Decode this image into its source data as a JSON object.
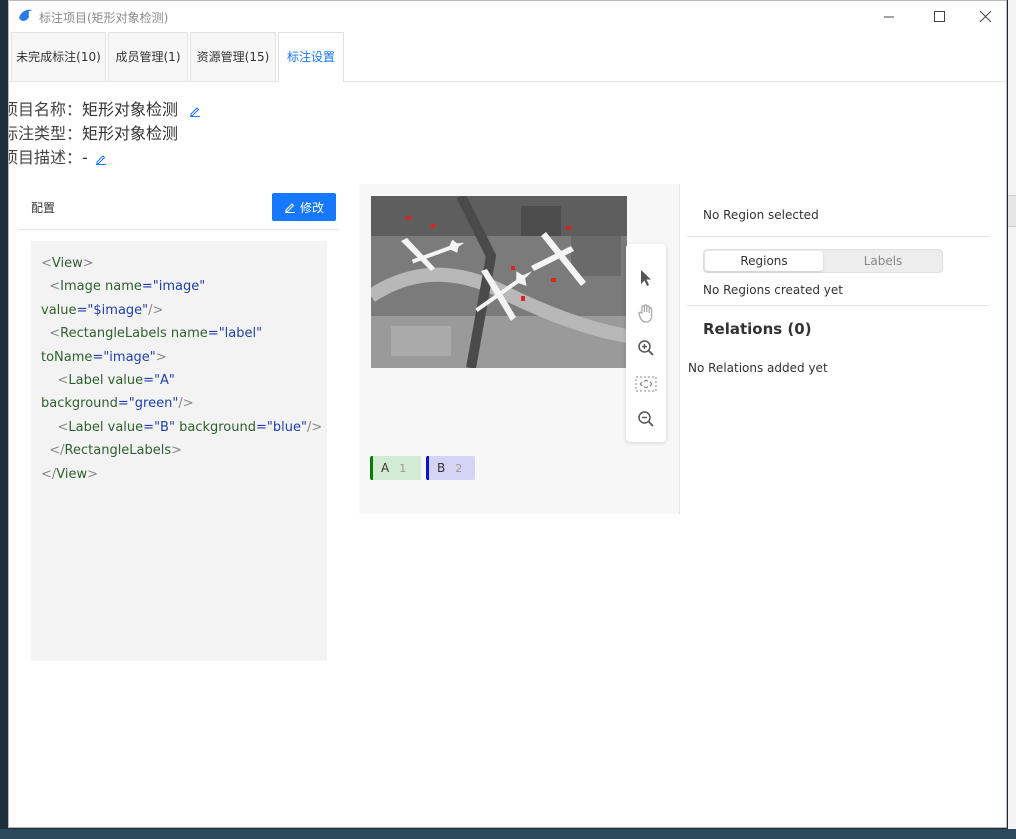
{
  "window": {
    "title": "标注项目(矩形对象检测)",
    "controls": {
      "minimize": "—",
      "maximize": "☐",
      "close": "✕"
    }
  },
  "tabs": [
    {
      "label": "未完成标注(10)"
    },
    {
      "label": "成员管理(1)"
    },
    {
      "label": "资源管理(15)"
    },
    {
      "label": "标注设置"
    }
  ],
  "active_tab": "标注设置",
  "project": {
    "name_label": "标注项目名称：",
    "name_value": "矩形对象检测",
    "type_label": "标注类型：",
    "type_value": "矩形对象检测",
    "desc_label": "标注项目描述：",
    "desc_value": "-"
  },
  "config": {
    "title": "配置",
    "modify_button": "修改",
    "code_lines": [
      [
        "<",
        "View",
        ">"
      ],
      [
        "  <",
        "Image",
        " name",
        "=",
        "\"image\""
      ],
      [
        "value",
        "=",
        "\"$image\"",
        "/>"
      ],
      [
        "  <",
        "RectangleLabels",
        " name",
        "=",
        "\"label\""
      ],
      [
        "toName",
        "=",
        "\"image\"",
        ">"
      ],
      [
        "    <",
        "Label",
        " value",
        "=",
        "\"A\""
      ],
      [
        "background",
        "=",
        "\"green\"",
        "/>"
      ],
      [
        "    <",
        "Label",
        " value",
        "=",
        "\"B\"",
        " background",
        "=",
        "\"blue\"",
        "/>"
      ],
      [
        "  </",
        "RectangleLabels",
        ">"
      ],
      [
        "</",
        "View",
        ">"
      ]
    ]
  },
  "preview": {
    "labels": [
      {
        "name": "A",
        "hotkey": "1",
        "color": "#0a7a0a"
      },
      {
        "name": "B",
        "hotkey": "2",
        "color": "#1010d0"
      }
    ]
  },
  "side_panel": {
    "no_region": "No Region selected",
    "tabs": {
      "regions": "Regions",
      "labels": "Labels"
    },
    "no_regions_text": "No Regions created yet",
    "relations_title": "Relations (0)",
    "no_relations_text": "No Relations added yet"
  },
  "colors": {
    "accent": "#1677ff"
  }
}
